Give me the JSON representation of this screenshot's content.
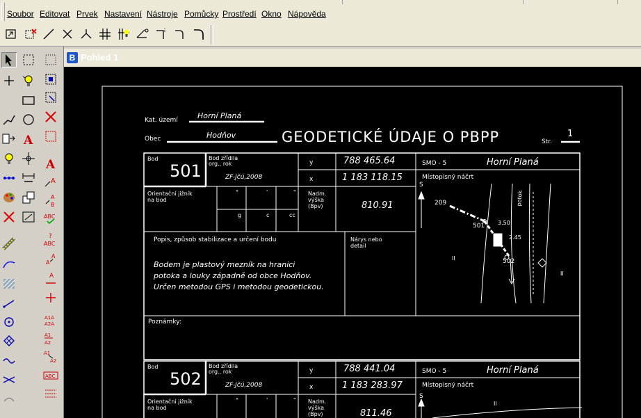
{
  "menu": [
    "Soubor",
    "Editovat",
    "Prvek",
    "Nastavení",
    "Nástroje",
    "Pomůcky",
    "Prostředí",
    "Okno",
    "Nápověda"
  ],
  "window": {
    "title": "Pohled 1",
    "icon_letter": "B"
  },
  "toolbar_icons": [
    "fence-icon",
    "delete-fence-icon",
    "line-icon",
    "cross-icon",
    "branch-icon",
    "parallel-lines-icon",
    "parallel-bulb-icon",
    "angle-icon",
    "corner-icon",
    "arc-corner-icon",
    "rounded-corner-icon"
  ],
  "tools_col1": [
    "select-arrow-icon",
    "point-icon",
    "line-string-icon",
    "place-cell-icon",
    "bulb-icon",
    "multi-point-icon",
    "palette-icon",
    "delete-icon",
    "separator",
    "ruler-icon",
    "curve-icon",
    "hatch-icon",
    "line-segment-icon",
    "circle-target-icon",
    "diamond-icon",
    "wave-icon",
    "intersect-icon",
    "arc-icon"
  ],
  "tools_col2": [
    "selection-box-icon",
    "light-bulb-icon",
    "rectangle-icon",
    "circle-icon",
    "text-a-icon",
    "target-icon",
    "dimension-icon",
    "copy-icon",
    "measure-icon"
  ],
  "tools_col3": [
    "dotted-box-icon",
    "fence-select-icon",
    "fence-clip-icon",
    "fence-delete-icon",
    "fence-dashed-icon",
    "separator",
    "text-icon",
    "edit-text-icon",
    "text-step-icon",
    "spell-check-icon",
    "text-query-icon",
    "text-change-icon",
    "text-node-icon",
    "text-place-icon",
    "text-font-icon",
    "text-a1a2-icon",
    "text-underline-icon",
    "text-a1-a2-icon",
    "text-abc-icon",
    "text-lines-icon"
  ],
  "drawing": {
    "kat_label": "Kat. území",
    "kat_value": "Horní Planá",
    "obec_label": "Obec",
    "obec_value": "Hodňov",
    "title": "GEODETICKÉ ÚDAJE O PBPP",
    "str_label": "Str.",
    "str_value": "1",
    "bod_label": "Bod",
    "zridil_label_1": "Bod zřídila",
    "zridil_label_2": "org., rok",
    "y_label": "y",
    "x_label": "x",
    "smo_label": "SMO - 5",
    "mistopis_label": "Místopisný náčrt",
    "orient_label_1": "Orientační jižník",
    "orient_label_2": "na bod",
    "deg": "°",
    "min": "'",
    "sec": "\"",
    "g": "g",
    "c": "c",
    "cc": "cc",
    "vyska_label_1": "Nadm.",
    "vyska_label_2": "výška",
    "vyska_label_3": "(Bpv)",
    "popis_label": "Popis, způsob stabilizace a určení bodu",
    "nakres_label_1": "Nárys nebo",
    "nakres_label_2": "detail",
    "poznamky_label": "Poznámky:",
    "s_label": "S",
    "points": [
      {
        "bod": "501",
        "zridil": "ZF-Jčú,2008",
        "y": "788 465.64",
        "x": "1 183 118.15",
        "smo_place": "Horní Planá",
        "vyska": "810.91",
        "popis": [
          "Bodem je plastový mezník na hranici",
          "potoka a louky západně od obce Hodňov.",
          "Určen metodou GPS i metodou geodetickou."
        ],
        "sketch_labels": [
          "209",
          "501",
          "502",
          "3.50",
          "2.45",
          "II",
          "II",
          "potok"
        ]
      },
      {
        "bod": "502",
        "zridil": "ZF-Jčú,2008",
        "y": "788 441.04",
        "x": "1 183 283.97",
        "smo_place": "Horní Planá",
        "vyska": "811.46",
        "sketch_labels": [
          "II"
        ]
      }
    ]
  }
}
